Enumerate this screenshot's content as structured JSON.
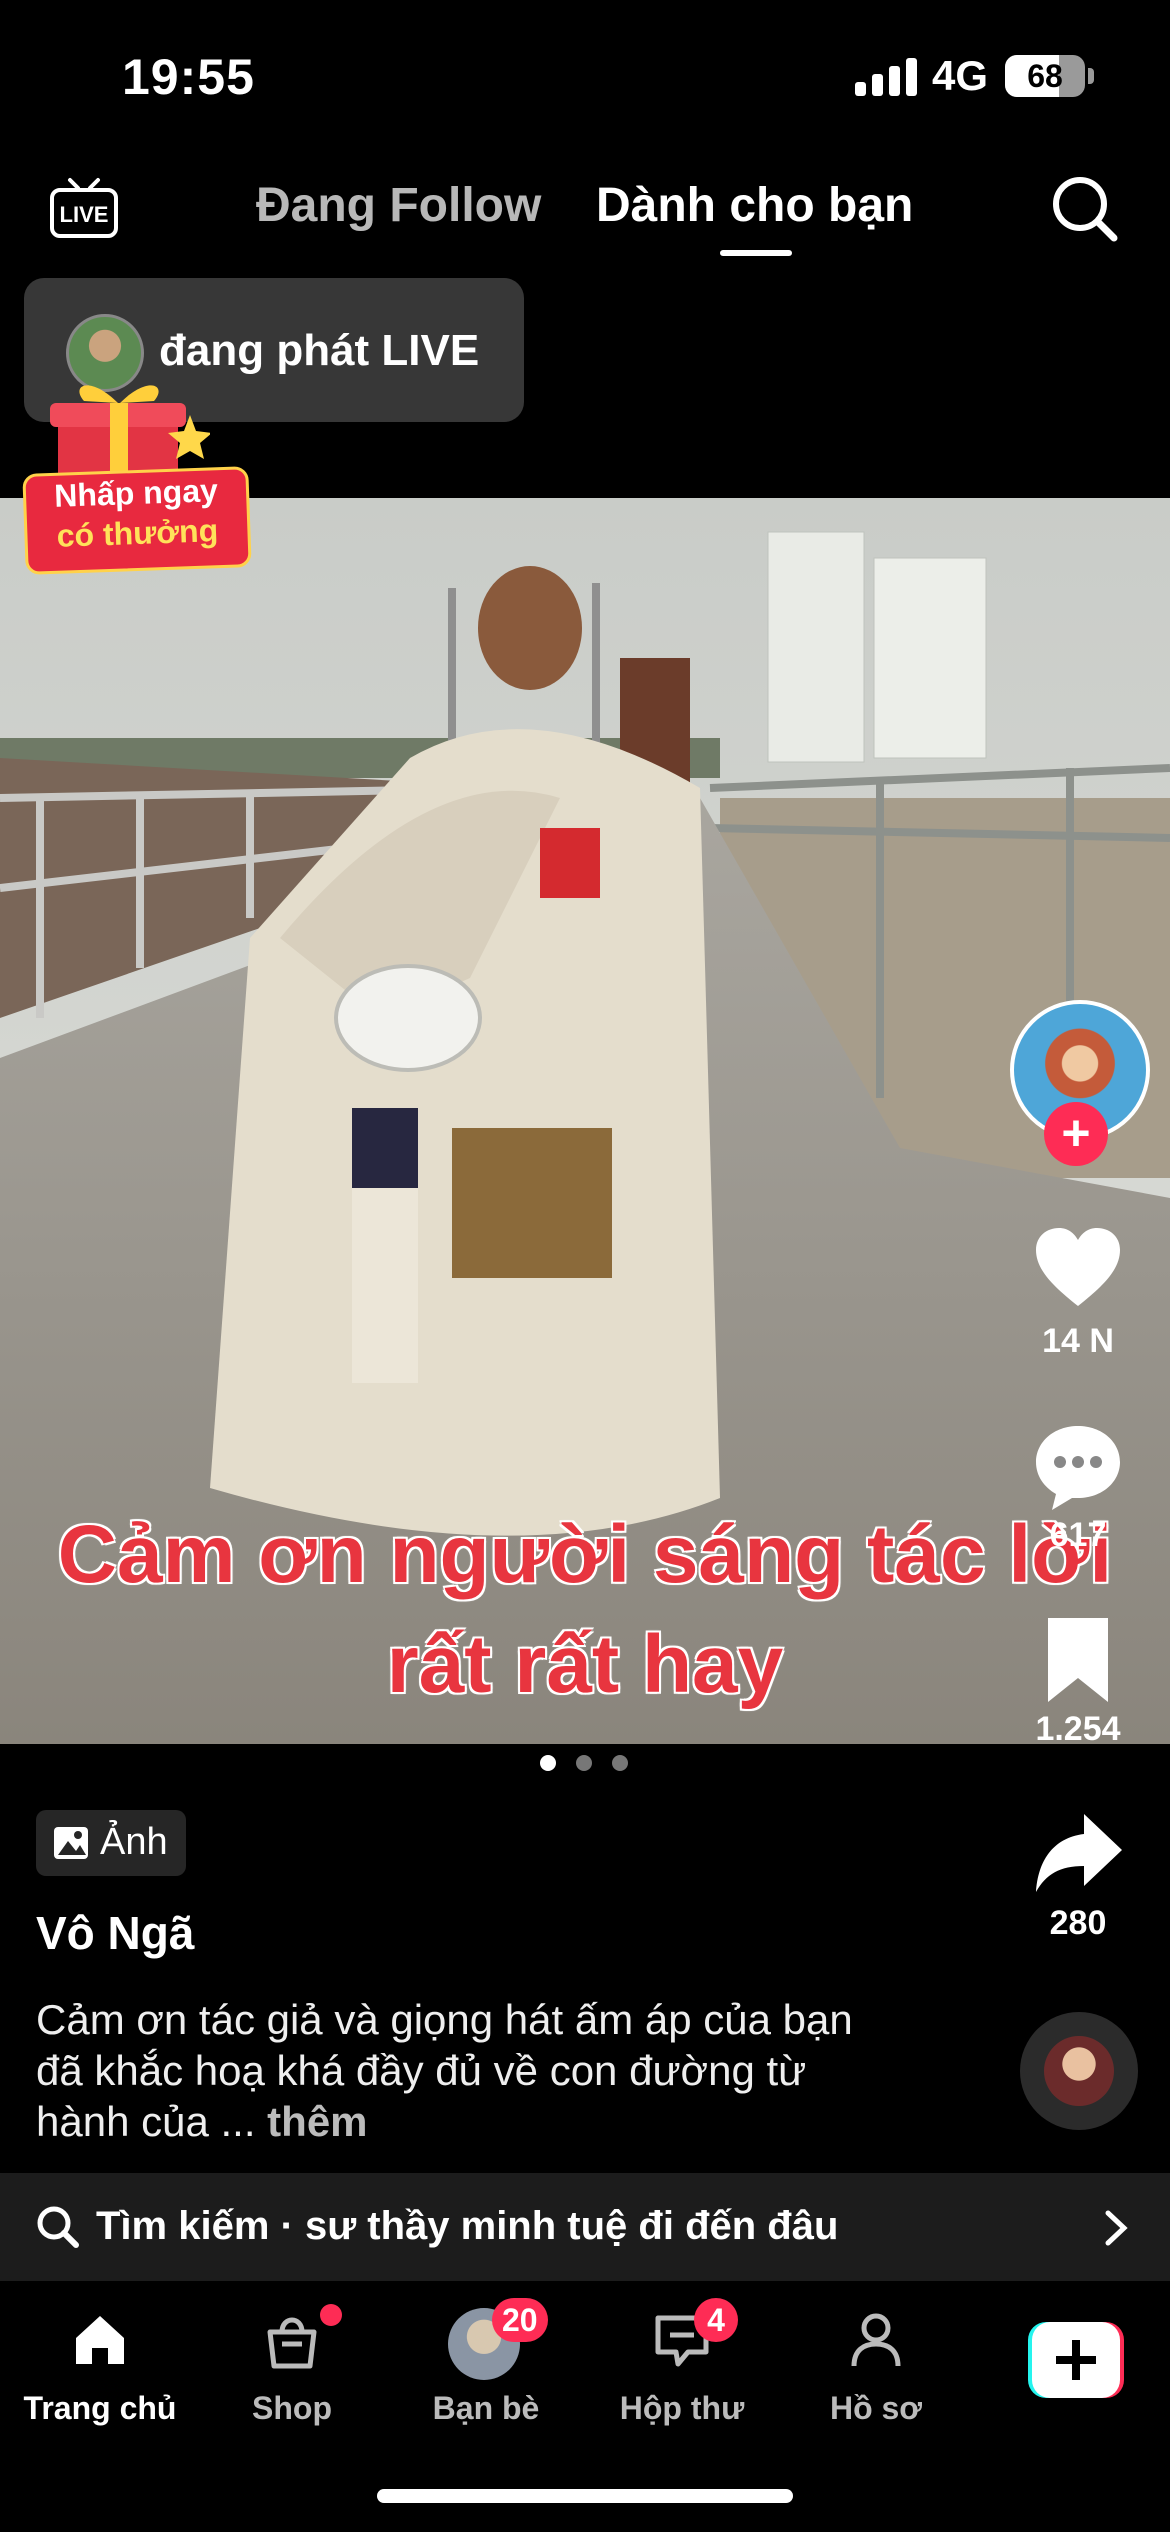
{
  "status_bar": {
    "time": "19:55",
    "network": "4G",
    "battery": "68"
  },
  "top_nav": {
    "live_icon": "live-tv-icon",
    "tabs": [
      {
        "label": "Đang Follow",
        "active": false
      },
      {
        "label": "Dành cho bạn",
        "active": true
      }
    ],
    "search_icon": "search-icon"
  },
  "live_popup": {
    "text": "đang phát LIVE"
  },
  "reward_badge": {
    "line1": "Nhấp ngay",
    "line2": "có thưởng"
  },
  "media": {
    "caption_line1": "Cảm ơn người sáng tác lời",
    "caption_line2": "rất rất hay",
    "carousel_dots": 3,
    "active_dot": 1
  },
  "actions": {
    "likes": "14 N",
    "comments": "617",
    "saves": "1.254",
    "shares": "280"
  },
  "post": {
    "type_label": "Ảnh",
    "author": "Vô Ngã",
    "description": "Cảm ơn tác giả và giọng hát ấm áp của bạn đã khắc hoạ khá đầy đủ về con đường từ hành của ...",
    "more": "thêm"
  },
  "search_suggestion": {
    "text": "Tìm kiếm · sư thầy minh tuệ đi đến đâu"
  },
  "bottom_nav": {
    "items": [
      {
        "label": "Trang chủ",
        "icon": "home-icon",
        "active": true
      },
      {
        "label": "Shop",
        "icon": "shopping-bag-icon"
      },
      {
        "label": "Bạn bè",
        "icon": "friends-avatar",
        "badge": "20"
      },
      {
        "label": "Hộp thư",
        "icon": "inbox-icon",
        "badge": "4"
      },
      {
        "label": "Hồ sơ",
        "icon": "profile-icon"
      }
    ],
    "create_icon": "create-plus-icon"
  },
  "colors": {
    "accent": "#fe2c55",
    "caption": "#e8353f",
    "background": "#000000"
  }
}
